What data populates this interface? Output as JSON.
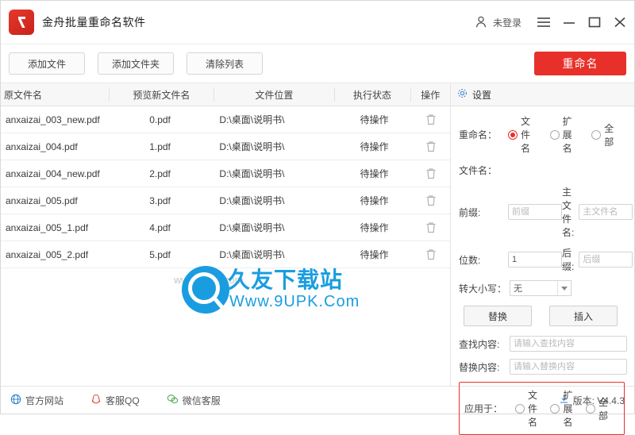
{
  "window": {
    "app_title": "金舟批量重命名软件",
    "login_label": "未登录",
    "controls": {
      "menu": "menu-icon",
      "minimize": "minimize-icon",
      "maximize": "maximize-icon",
      "close": "close-icon"
    }
  },
  "toolbar": {
    "add_file": "添加文件",
    "add_folder": "添加文件夹",
    "clear_list": "清除列表",
    "rename": "重命名"
  },
  "table": {
    "headers": {
      "original": "原文件名",
      "preview": "预览新文件名",
      "location": "文件位置",
      "status": "执行状态",
      "action": "操作"
    },
    "rows": [
      {
        "original": "anxaizai_003_new.pdf",
        "preview": "0.pdf",
        "location": "D:\\桌面\\说明书\\",
        "status": "待操作",
        "action": "delete-icon"
      },
      {
        "original": "anxaizai_004.pdf",
        "preview": "1.pdf",
        "location": "D:\\桌面\\说明书\\",
        "status": "待操作",
        "action": "delete-icon"
      },
      {
        "original": "anxaizai_004_new.pdf",
        "preview": "2.pdf",
        "location": "D:\\桌面\\说明书\\",
        "status": "待操作",
        "action": "delete-icon"
      },
      {
        "original": "anxaizai_005.pdf",
        "preview": "3.pdf",
        "location": "D:\\桌面\\说明书\\",
        "status": "待操作",
        "action": "delete-icon"
      },
      {
        "original": "anxaizai_005_1.pdf",
        "preview": "4.pdf",
        "location": "D:\\桌面\\说明书\\",
        "status": "待操作",
        "action": "delete-icon"
      },
      {
        "original": "anxaizai_005_2.pdf",
        "preview": "5.pdf",
        "location": "D:\\桌面\\说明书\\",
        "status": "待操作",
        "action": "delete-icon"
      }
    ]
  },
  "watermark": {
    "main": "久友下载站",
    "sub": "Www.9UPK.Com",
    "ghost": "www.9upk.com"
  },
  "settings": {
    "title": "设置",
    "rename_label": "重命名：",
    "rename_options": [
      "文件名",
      "扩展名",
      "全部"
    ],
    "rename_selected": "文件名",
    "filename_label": "文件名：",
    "prefix_label": "前缀:",
    "prefix_placeholder": "前缀",
    "main_name_label": "主文件名:",
    "main_name_placeholder": "主文件名",
    "digits_label": "位数:",
    "digits_value": "1",
    "suffix_label": "后缀:",
    "suffix_placeholder": "后缀",
    "case_label": "转大小写：",
    "case_value": "无",
    "replace_btn": "替换",
    "insert_btn": "插入",
    "find_label": "查找内容:",
    "find_placeholder": "请输入查找内容",
    "replace_label": "替换内容:",
    "replace_placeholder": "请输入替换内容",
    "apply_label": "应用于：",
    "apply_options": [
      "文件名",
      "扩展名",
      "全部"
    ],
    "apply_selected": ""
  },
  "footer": {
    "site": "官方网站",
    "qq": "客服QQ",
    "wechat": "微信客服",
    "version": "版本: V4.4.3"
  },
  "colors": {
    "accent": "#e8302a",
    "watermark": "#1a9de0",
    "header_bg": "#f7f7f7"
  }
}
